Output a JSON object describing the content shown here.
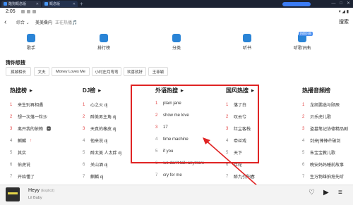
{
  "browser": {
    "tabs": [
      {
        "label": "酷狗概念版",
        "color": "#3f8ef5"
      },
      {
        "label": "概念版",
        "color": "#4a9af7"
      }
    ],
    "add_tab": "+",
    "window_controls": [
      "—",
      "□",
      "✕"
    ]
  },
  "status_bar": {
    "time": "2:05",
    "right": "▾ ◢ ▮"
  },
  "search": {
    "back": "‹",
    "scope": "综合 ⌄",
    "query": "美美桑内",
    "hint": "正在热播🎵",
    "button": "搜索"
  },
  "categories": [
    {
      "label": "歌手",
      "icon": "singer-icon"
    },
    {
      "label": "排行榜",
      "icon": "chart-icon"
    },
    {
      "label": "分类",
      "icon": "category-icon"
    },
    {
      "label": "听书",
      "icon": "audiobook-icon"
    },
    {
      "label": "听歌识曲",
      "icon": "song-recognition-icon",
      "badge": "拍照识曲"
    }
  ],
  "guess": {
    "title": "猜你想搜",
    "chips": [
      "孤城相长",
      "文夫",
      "Money Loves Me",
      "小村庄月弯弯",
      "欢喜就好",
      "王菲颖"
    ]
  },
  "panels": [
    {
      "title": "热搜榜",
      "items": [
        {
          "n": "1",
          "text": "来生别再相遇",
          "hot": true
        },
        {
          "n": "2",
          "text": "想一次落一粒沙",
          "hot": true
        },
        {
          "n": "3",
          "text": "离开我的依赖",
          "hot": true,
          "tag": "🅷"
        },
        {
          "n": "4",
          "text": "麒麟",
          "hot": false,
          "up": "↑"
        },
        {
          "n": "5",
          "text": "其实",
          "hot": false
        },
        {
          "n": "6",
          "text": "伯虎说",
          "hot": false
        },
        {
          "n": "7",
          "text": "开始懂了",
          "hot": false
        }
      ]
    },
    {
      "title": "DJ榜",
      "items": [
        {
          "n": "1",
          "text": "心之火 dj",
          "hot": true
        },
        {
          "n": "2",
          "text": "醉美男主角 dj",
          "hot": true
        },
        {
          "n": "3",
          "text": "天真的橡皮 dj",
          "hot": true
        },
        {
          "n": "4",
          "text": "他来说 dj",
          "hot": false
        },
        {
          "n": "5",
          "text": "醉太美 人太胖 dj",
          "hot": false
        },
        {
          "n": "6",
          "text": "关山酒 dj",
          "hot": false
        },
        {
          "n": "7",
          "text": "麒麟 dj",
          "hot": false
        }
      ]
    },
    {
      "title": "外语热搜",
      "items": [
        {
          "n": "1",
          "text": "plain jane",
          "hot": true
        },
        {
          "n": "2",
          "text": "show me love",
          "hot": true
        },
        {
          "n": "3",
          "text": "17",
          "hot": true
        },
        {
          "n": "4",
          "text": "time machine",
          "hot": false
        },
        {
          "n": "5",
          "text": "if you",
          "hot": false
        },
        {
          "n": "6",
          "text": "we don't talk anymore",
          "hot": false
        },
        {
          "n": "7",
          "text": "cry for me",
          "hot": false
        }
      ]
    },
    {
      "title": "国风热搜",
      "items": [
        {
          "n": "1",
          "text": "落了白",
          "hot": true
        },
        {
          "n": "2",
          "text": "叹云兮",
          "hot": true
        },
        {
          "n": "3",
          "text": "红尘客栈",
          "hot": true
        },
        {
          "n": "4",
          "text": "牵丝戏",
          "hot": false
        },
        {
          "n": "5",
          "text": "天下",
          "hot": false
        },
        {
          "n": "6",
          "text": "年轮",
          "hot": false
        },
        {
          "n": "7",
          "text": "醉九引阳春",
          "hot": false
        }
      ]
    },
    {
      "title": "热播音频榜",
      "items": [
        {
          "n": "1",
          "text": "龙凯鹏选与顾辰",
          "hot": true
        },
        {
          "n": "2",
          "text": "贝乐虎儿歌",
          "hot": true
        },
        {
          "n": "3",
          "text": "盗墓笔记协德精品剧",
          "hot": true
        },
        {
          "n": "4",
          "text": "剑来|锋锋芒破剑",
          "hot": false
        },
        {
          "n": "5",
          "text": "朱宝宝教儿歌",
          "hot": false
        },
        {
          "n": "6",
          "text": "晚安妈妈睡前故事",
          "hot": false
        },
        {
          "n": "7",
          "text": "生万物雄拍抢先听",
          "hot": false
        }
      ]
    }
  ],
  "player": {
    "title": "Heyy",
    "explicit": "(Explicit)",
    "artist": "Lil Baby",
    "controls": [
      "♡",
      "▶",
      "≡"
    ]
  },
  "annotation_color": "#e02424"
}
